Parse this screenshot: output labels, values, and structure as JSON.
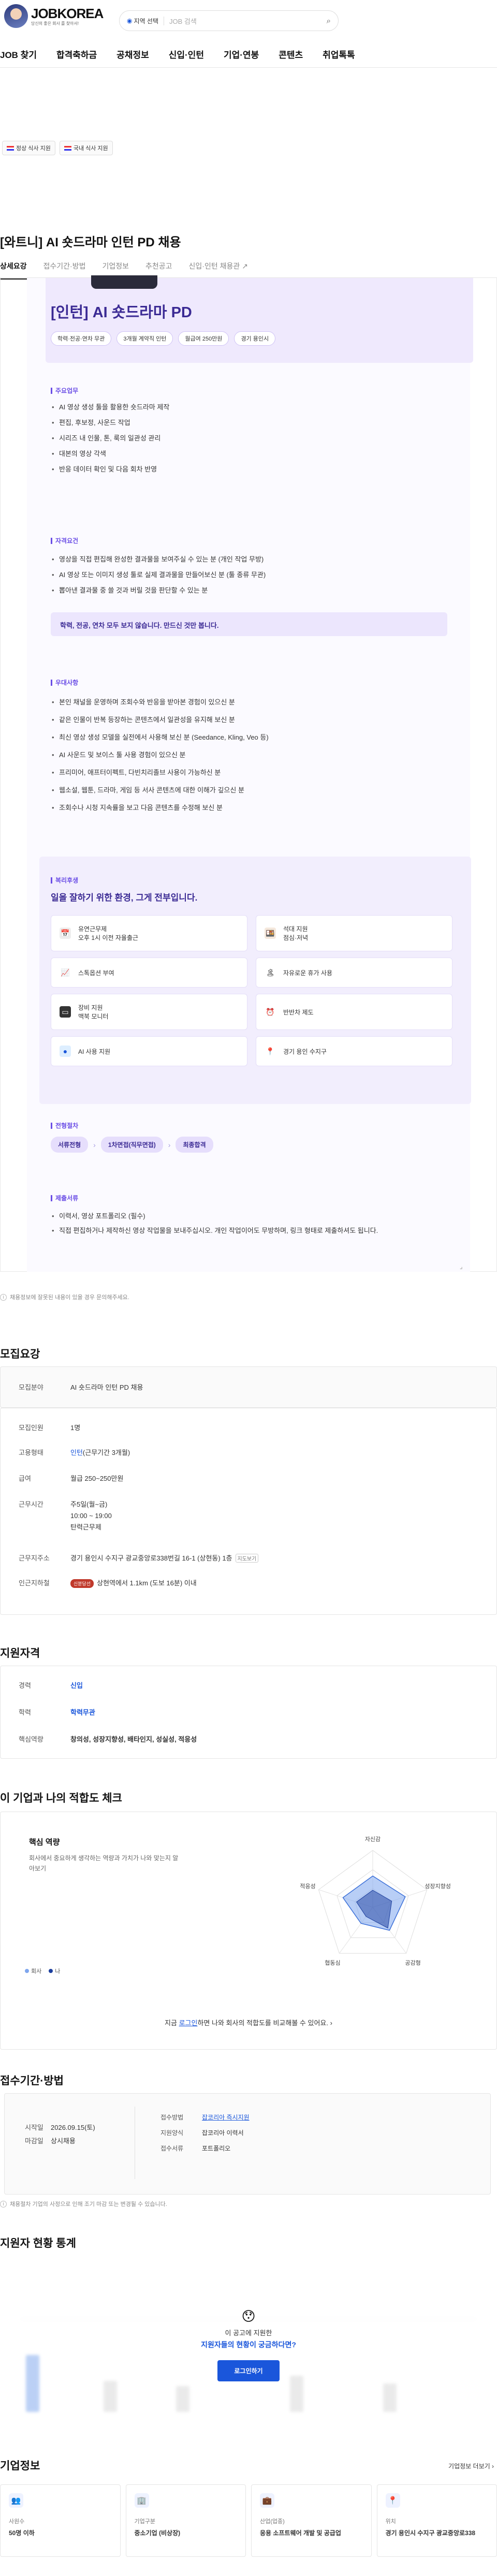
{
  "header": {
    "logo": "JOBKOREA",
    "logo_sub": "당신의 좋은 회사 를 찾아서!",
    "location_label": "지역 선택",
    "search_placeholder": "JOB 검색",
    "nav": [
      "JOB 찾기",
      "합격축하금",
      "공채정보",
      "신입·인턴",
      "기업·연봉",
      "콘텐츠",
      "취업톡톡"
    ]
  },
  "filters": [
    "정상 식사 지원",
    "국내 식사 지원"
  ],
  "job": {
    "title": "[와트니] AI 숏드라마 인턴 PD 채용",
    "tabs": [
      "상세요강",
      "접수기간·방법",
      "기업정보",
      "추천공고",
      "신입·인턴 채용관"
    ],
    "hero_tag": "",
    "hero_title": "[인턴] AI 숏드라마 PD",
    "pills": [
      "학력·전공·연차 무관",
      "3개월 계약직 인턴",
      "월급여 250만원",
      "경기 용인시"
    ]
  },
  "duties": {
    "label": "주요업무",
    "items": [
      "AI 영상 생성 툴을 활용한 숏드라마 제작",
      "편집, 후보정, 사운드 작업",
      "시리즈 내 인물, 톤, 룩의 일관성 관리",
      "대본의 영상 각색",
      "반응 데이터 확인 및 다음 회차 반영"
    ]
  },
  "qualifications": {
    "label": "자격요건",
    "items": [
      "영상을 직접 편집해 완성한 결과물을 보여주실 수 있는 분 (개인 작업 무방)",
      "AI 영상 또는 이미지 생성 툴로 실제 결과물을 만들어보신 분 (툴 종류 무관)",
      "뽑아낸 결과물 중 쓸 것과 버릴 것을 판단할 수 있는 분"
    ],
    "notice": "학력, 전공, 연차 모두 보지 않습니다. 만드신 것만 봅니다."
  },
  "preferred": {
    "label": "우대사항",
    "items": [
      "본인 채널을 운영하며 조회수와 반응을 받아본 경험이 있으신 분",
      "같은 인물이 반복 등장하는 콘텐츠에서 일관성을 유지해 보신 분",
      "최신 영상 생성 모델을 실전에서 사용해 보신 분 (Seedance, Kling, Veo 등)",
      "AI 사운드 및 보이스 툴 사용 경험이 있으신 분",
      "프리미어, 애프터이펙트, 다빈치리졸브 사용이 가능하신 분",
      "웹소설, 웹툰, 드라마, 게임 등 서사 콘텐츠에 대한 이해가 깊으신 분",
      "조회수나 시청 지속률을 보고 다음 콘텐츠를 수정해 보신 분"
    ]
  },
  "benefits": {
    "label": "복리후생",
    "headline": "일을 잘하기 위한 환경, 그게 전부입니다.",
    "items": [
      {
        "icon": "calendar-icon",
        "text": "유연근무제\n오후 1시 이전 자율출근"
      },
      {
        "icon": "meal-icon",
        "text": "석대 지원\n점심·저녁"
      },
      {
        "icon": "chart-icon",
        "text": "스톡옵션 부여"
      },
      {
        "icon": "gift-icon",
        "text": "자유로운 휴가 사용"
      },
      {
        "icon": "monitor-icon",
        "text": "장비 지원\n맥북 모니터"
      },
      {
        "icon": "clock-icon",
        "text": "반반차 제도"
      },
      {
        "icon": "ai-icon",
        "text": "AI 사용 지원"
      },
      {
        "icon": "pin-icon",
        "text": "경기 용인 수지구"
      }
    ]
  },
  "process": {
    "label": "전형절차",
    "steps": [
      "서류전형",
      "1차면접(직무면접)",
      "최종합격"
    ]
  },
  "documents": {
    "label": "제출서류",
    "items": [
      "이력서, 영상 포트폴리오 (필수)",
      "직접 편집하거나 제작하신 영상 작업물을 보내주십시오. 개인 작업이어도 무방하며, 링크 형태로 제출하셔도 됩니다."
    ]
  },
  "report_note": "채용정보에 잘못된 내용이 있을 경우 문의해주세요.",
  "summary": {
    "heading": "모집요강",
    "field_label": "모집분야",
    "field_value": "AI 숏드라마 인턴 PD 채용",
    "rows": [
      {
        "k": "모집인원",
        "v": "1명"
      },
      {
        "k": "고용형태",
        "v": "인턴",
        "sub": "(근무기간 3개월)"
      },
      {
        "k": "급여",
        "v": "월급 250~250만원"
      },
      {
        "k": "근무시간",
        "v": "주5일(월~금)",
        "lines": [
          "10:00 ~ 19:00",
          "탄력근무제"
        ]
      },
      {
        "k": "근무지주소",
        "v": "경기 용인시 수지구 광교중앙로338번길 16-1 (상현동) 1층",
        "btn": "지도보기"
      },
      {
        "k": "인근지하철",
        "v": "상현역에서 1.1km (도보 16분) 이내",
        "badge": "신분당선"
      }
    ]
  },
  "applicant_req": {
    "heading": "지원자격",
    "rows": [
      {
        "k": "경력",
        "v": "신입"
      },
      {
        "k": "학력",
        "v": "학력무관"
      },
      {
        "k": "핵심역량",
        "v": "창의성, 성장지향성, 배타인지, 성실성, 적응성"
      }
    ]
  },
  "fit": {
    "heading": "이 기업과 나의 적합도 체크",
    "card_title": "핵심 역량",
    "card_desc": "회사에서 중요하게 생각하는 역량과 가치가 나와 맞는지 알아보기",
    "axes": [
      "자신감",
      "성장지향성",
      "공감형",
      "협동심",
      "적응성"
    ],
    "company_scores": [
      0.55,
      0.6,
      0.5,
      0.35,
      0.55
    ],
    "me_scores": [
      0.3,
      0.35,
      0.45,
      0.2,
      0.3
    ],
    "legend": [
      "회사",
      "나"
    ],
    "cta_prefix": "지금",
    "cta_link": "로그인",
    "cta_suffix": "하면 나와 회사의 적합도를 비교해볼 수 있어요."
  },
  "apply": {
    "heading": "접수기간·방법",
    "start_label": "시작일",
    "start": "2026.09.15(토)",
    "end_label": "마감일",
    "end": "상시채용",
    "method_label": "접수방법",
    "method": "잡코리아 즉시지원",
    "form_label": "지원양식",
    "form": "잡코리아 이력서",
    "docs_label": "접수서류",
    "docs": "포트폴리오",
    "note": "채용절차 기업의 사정으로 인해 조기 마감 또는 변경될 수 있습니다."
  },
  "stats": {
    "heading": "지원자 현황 통계",
    "overlay_line1": "이 공고에 지원한",
    "overlay_line2": "지원자들의 현황이 궁금하다면?",
    "overlay_button": "로그인하기"
  },
  "company": {
    "heading": "기업정보",
    "more": "기업정보 더보기",
    "cards": [
      {
        "icon": "people-icon",
        "label": "사원수",
        "value": "50명 이하"
      },
      {
        "icon": "building-icon",
        "label": "기업구분",
        "value": "중소기업 (비상장)"
      },
      {
        "icon": "briefcase-icon",
        "label": "산업(업종)",
        "value": "응용 소프트웨어 개발 및 공급업"
      },
      {
        "icon": "location-icon",
        "label": "위치",
        "value": "경기 용인시 수지구 광교중앙로338"
      }
    ]
  }
}
